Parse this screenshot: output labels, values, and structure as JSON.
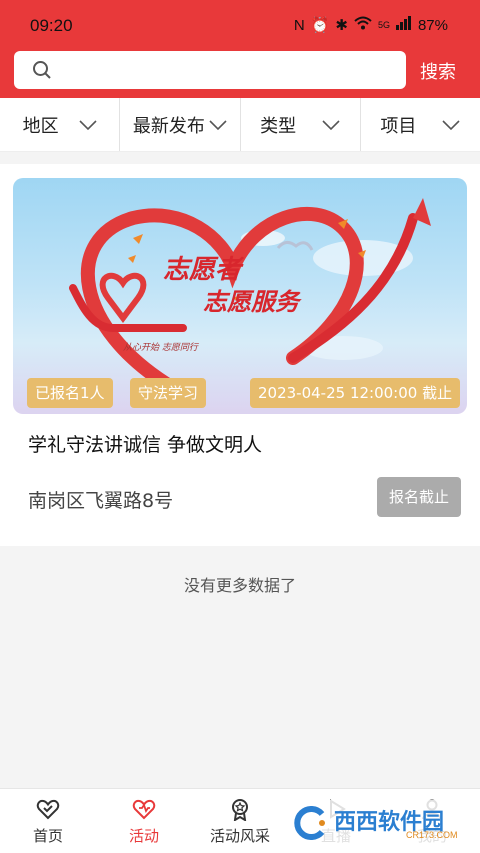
{
  "status_bar": {
    "time": "09:20",
    "battery": "87%",
    "network": "5G"
  },
  "search": {
    "placeholder": "",
    "button_label": "搜索"
  },
  "filters": [
    {
      "label": "地区"
    },
    {
      "label": "最新发布"
    },
    {
      "label": "类型"
    },
    {
      "label": "项目"
    }
  ],
  "activity": {
    "tags": {
      "signup": "已报名1人",
      "category": "守法学习",
      "deadline": "2023-04-25 12:00:00 截止"
    },
    "image_text": {
      "line1": "志愿者",
      "line2": "志愿服务",
      "slogan": "从心开始 志愿同行"
    },
    "title": "学礼守法讲诚信 争做文明人",
    "address": "南岗区飞翼路8号",
    "status_button": "报名截止"
  },
  "list_footer": "没有更多数据了",
  "tabbar": {
    "items": [
      {
        "label": "首页",
        "icon": "home-heart-icon"
      },
      {
        "label": "活动",
        "icon": "activity-heart-icon",
        "active": true
      },
      {
        "label": "活动风采",
        "icon": "medal-icon"
      },
      {
        "label": "直播",
        "icon": "play-icon"
      },
      {
        "label": "我的",
        "icon": "user-icon"
      }
    ]
  },
  "watermark": {
    "text": "西西软件园",
    "sub": "CR173.COM"
  },
  "colors": {
    "brand": "#e8393a",
    "tag": "#e7bc6c",
    "disabled_button": "#ababab"
  }
}
